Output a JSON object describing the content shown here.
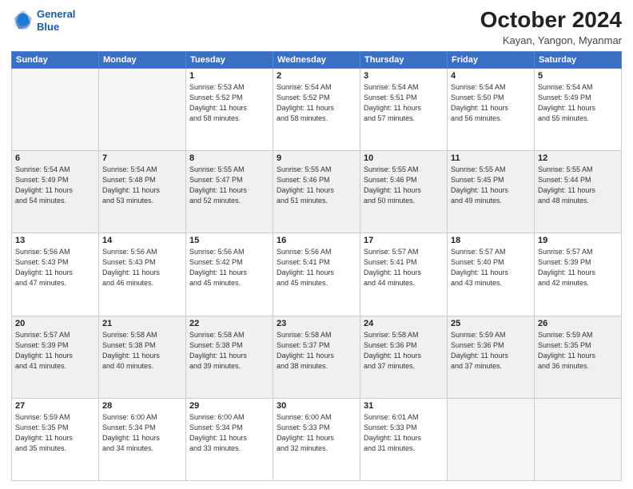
{
  "header": {
    "logo_line1": "General",
    "logo_line2": "Blue",
    "title": "October 2024",
    "subtitle": "Kayan, Yangon, Myanmar"
  },
  "weekdays": [
    "Sunday",
    "Monday",
    "Tuesday",
    "Wednesday",
    "Thursday",
    "Friday",
    "Saturday"
  ],
  "weeks": [
    [
      {
        "day": "",
        "info": ""
      },
      {
        "day": "",
        "info": ""
      },
      {
        "day": "1",
        "info": "Sunrise: 5:53 AM\nSunset: 5:52 PM\nDaylight: 11 hours\nand 58 minutes."
      },
      {
        "day": "2",
        "info": "Sunrise: 5:54 AM\nSunset: 5:52 PM\nDaylight: 11 hours\nand 58 minutes."
      },
      {
        "day": "3",
        "info": "Sunrise: 5:54 AM\nSunset: 5:51 PM\nDaylight: 11 hours\nand 57 minutes."
      },
      {
        "day": "4",
        "info": "Sunrise: 5:54 AM\nSunset: 5:50 PM\nDaylight: 11 hours\nand 56 minutes."
      },
      {
        "day": "5",
        "info": "Sunrise: 5:54 AM\nSunset: 5:49 PM\nDaylight: 11 hours\nand 55 minutes."
      }
    ],
    [
      {
        "day": "6",
        "info": "Sunrise: 5:54 AM\nSunset: 5:49 PM\nDaylight: 11 hours\nand 54 minutes."
      },
      {
        "day": "7",
        "info": "Sunrise: 5:54 AM\nSunset: 5:48 PM\nDaylight: 11 hours\nand 53 minutes."
      },
      {
        "day": "8",
        "info": "Sunrise: 5:55 AM\nSunset: 5:47 PM\nDaylight: 11 hours\nand 52 minutes."
      },
      {
        "day": "9",
        "info": "Sunrise: 5:55 AM\nSunset: 5:46 PM\nDaylight: 11 hours\nand 51 minutes."
      },
      {
        "day": "10",
        "info": "Sunrise: 5:55 AM\nSunset: 5:46 PM\nDaylight: 11 hours\nand 50 minutes."
      },
      {
        "day": "11",
        "info": "Sunrise: 5:55 AM\nSunset: 5:45 PM\nDaylight: 11 hours\nand 49 minutes."
      },
      {
        "day": "12",
        "info": "Sunrise: 5:55 AM\nSunset: 5:44 PM\nDaylight: 11 hours\nand 48 minutes."
      }
    ],
    [
      {
        "day": "13",
        "info": "Sunrise: 5:56 AM\nSunset: 5:43 PM\nDaylight: 11 hours\nand 47 minutes."
      },
      {
        "day": "14",
        "info": "Sunrise: 5:56 AM\nSunset: 5:43 PM\nDaylight: 11 hours\nand 46 minutes."
      },
      {
        "day": "15",
        "info": "Sunrise: 5:56 AM\nSunset: 5:42 PM\nDaylight: 11 hours\nand 45 minutes."
      },
      {
        "day": "16",
        "info": "Sunrise: 5:56 AM\nSunset: 5:41 PM\nDaylight: 11 hours\nand 45 minutes."
      },
      {
        "day": "17",
        "info": "Sunrise: 5:57 AM\nSunset: 5:41 PM\nDaylight: 11 hours\nand 44 minutes."
      },
      {
        "day": "18",
        "info": "Sunrise: 5:57 AM\nSunset: 5:40 PM\nDaylight: 11 hours\nand 43 minutes."
      },
      {
        "day": "19",
        "info": "Sunrise: 5:57 AM\nSunset: 5:39 PM\nDaylight: 11 hours\nand 42 minutes."
      }
    ],
    [
      {
        "day": "20",
        "info": "Sunrise: 5:57 AM\nSunset: 5:39 PM\nDaylight: 11 hours\nand 41 minutes."
      },
      {
        "day": "21",
        "info": "Sunrise: 5:58 AM\nSunset: 5:38 PM\nDaylight: 11 hours\nand 40 minutes."
      },
      {
        "day": "22",
        "info": "Sunrise: 5:58 AM\nSunset: 5:38 PM\nDaylight: 11 hours\nand 39 minutes."
      },
      {
        "day": "23",
        "info": "Sunrise: 5:58 AM\nSunset: 5:37 PM\nDaylight: 11 hours\nand 38 minutes."
      },
      {
        "day": "24",
        "info": "Sunrise: 5:58 AM\nSunset: 5:36 PM\nDaylight: 11 hours\nand 37 minutes."
      },
      {
        "day": "25",
        "info": "Sunrise: 5:59 AM\nSunset: 5:36 PM\nDaylight: 11 hours\nand 37 minutes."
      },
      {
        "day": "26",
        "info": "Sunrise: 5:59 AM\nSunset: 5:35 PM\nDaylight: 11 hours\nand 36 minutes."
      }
    ],
    [
      {
        "day": "27",
        "info": "Sunrise: 5:59 AM\nSunset: 5:35 PM\nDaylight: 11 hours\nand 35 minutes."
      },
      {
        "day": "28",
        "info": "Sunrise: 6:00 AM\nSunset: 5:34 PM\nDaylight: 11 hours\nand 34 minutes."
      },
      {
        "day": "29",
        "info": "Sunrise: 6:00 AM\nSunset: 5:34 PM\nDaylight: 11 hours\nand 33 minutes."
      },
      {
        "day": "30",
        "info": "Sunrise: 6:00 AM\nSunset: 5:33 PM\nDaylight: 11 hours\nand 32 minutes."
      },
      {
        "day": "31",
        "info": "Sunrise: 6:01 AM\nSunset: 5:33 PM\nDaylight: 11 hours\nand 31 minutes."
      },
      {
        "day": "",
        "info": ""
      },
      {
        "day": "",
        "info": ""
      }
    ]
  ]
}
